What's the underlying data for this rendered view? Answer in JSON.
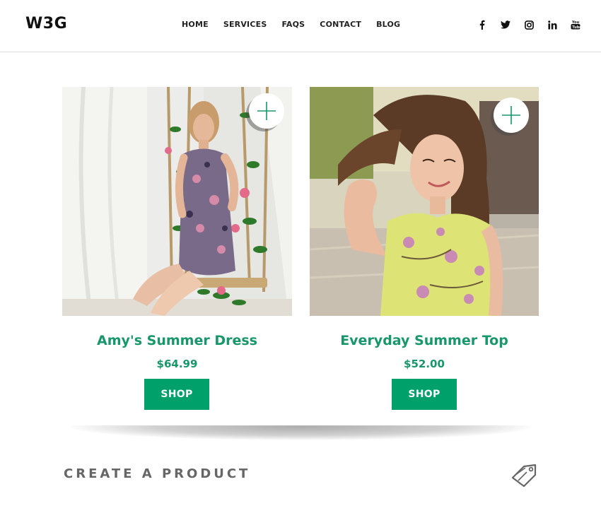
{
  "brand": {
    "logo": "W3G"
  },
  "nav": [
    "HOME",
    "SERVICES",
    "FAQS",
    "CONTACT",
    "BLOG"
  ],
  "social": [
    "facebook-icon",
    "twitter-icon",
    "instagram-icon",
    "linkedin-icon",
    "youtube-icon"
  ],
  "products": [
    {
      "name": "Amy's Summer Dress",
      "price": "$64.99",
      "button": "SHOP"
    },
    {
      "name": "Everyday Summer Top",
      "price": "$52.00",
      "button": "SHOP"
    }
  ],
  "create": {
    "label": "CREATE A PRODUCT"
  },
  "colors": {
    "accent": "#00a06a",
    "title": "#16986a",
    "text": "#222222",
    "muted": "#666666"
  }
}
